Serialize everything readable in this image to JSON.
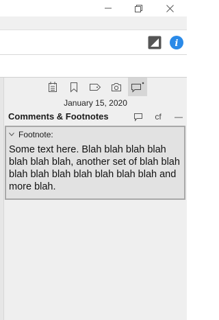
{
  "window": {
    "controls": [
      "minimize",
      "maximize",
      "close"
    ]
  },
  "toolbar": {
    "icons": [
      "layout-toggle-icon",
      "info-icon"
    ],
    "info_color": "#2a8ae8"
  },
  "inspector": {
    "tabs": [
      "notes-icon",
      "bookmark-icon",
      "tag-icon",
      "snapshot-icon",
      "comment-icon"
    ],
    "active_tab": "comment-icon",
    "date": "January 15, 2020",
    "section_title": "Comments & Footnotes",
    "add_comment_label": "",
    "add_footnote_label": "cf",
    "delete_label": "—",
    "note": {
      "label": "Footnote:",
      "text": "Some text here. Blah blah blah blah blah blah blah, another set of blah blah blah blah blah blah blah blah blah and more blah."
    }
  }
}
